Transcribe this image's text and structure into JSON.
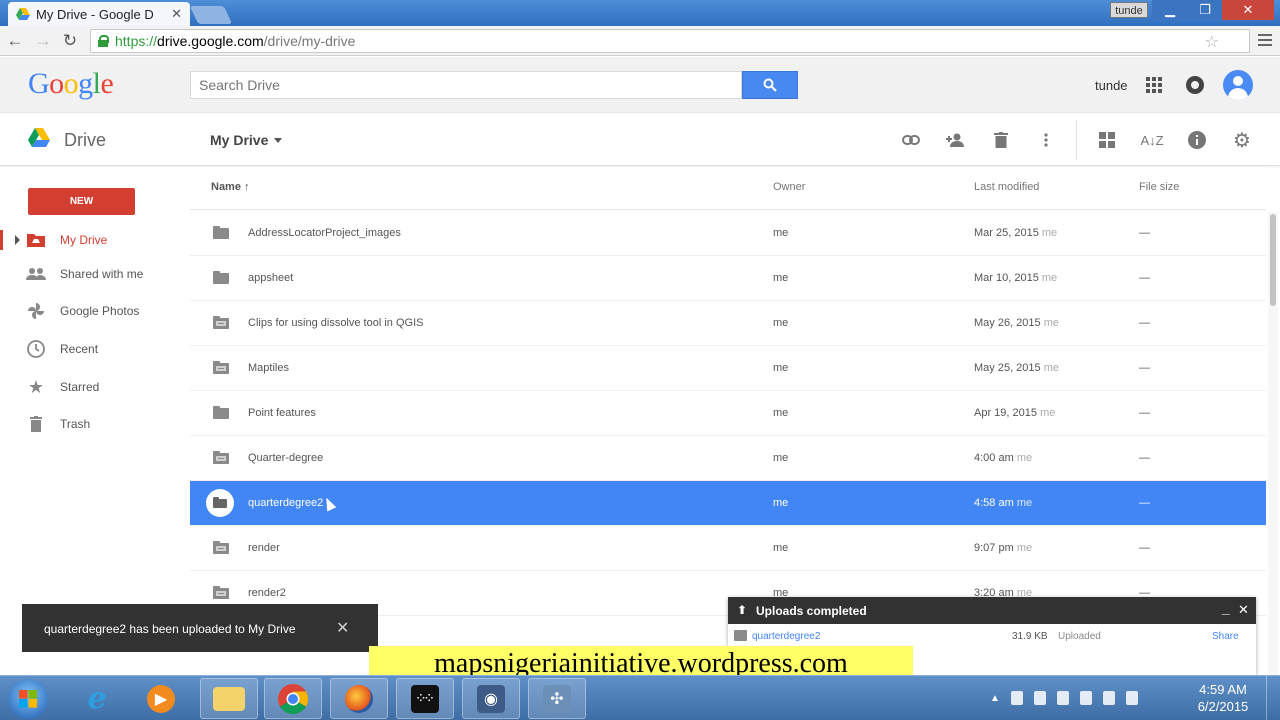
{
  "browser": {
    "tab_title": "My Drive - Google D",
    "tab_close": "✕",
    "profile_user": "tunde",
    "url_scheme": "https://",
    "url_host": "drive.google.com",
    "url_path": "/drive/my-drive"
  },
  "header": {
    "logo_letters": [
      "G",
      "o",
      "o",
      "g",
      "l",
      "e"
    ],
    "logo_colors": [
      "#4285f4",
      "#ea4335",
      "#fbbc05",
      "#4285f4",
      "#34a853",
      "#ea4335"
    ],
    "search_placeholder": "Search Drive",
    "user_name": "tunde"
  },
  "drive_bar": {
    "app_title": "Drive",
    "location": "My Drive"
  },
  "sidebar": {
    "new_label": "NEW",
    "items": [
      {
        "label": "My Drive",
        "icon": "drive-folder-icon",
        "active": true
      },
      {
        "label": "Shared with me",
        "icon": "people-icon",
        "active": false
      },
      {
        "label": "Google Photos",
        "icon": "photos-pinwheel-icon",
        "active": false
      },
      {
        "label": "Recent",
        "icon": "clock-icon",
        "active": false
      },
      {
        "label": "Starred",
        "icon": "star-icon",
        "active": false
      },
      {
        "label": "Trash",
        "icon": "trash-icon",
        "active": false
      }
    ]
  },
  "file_list": {
    "columns": {
      "name": "Name ↑",
      "owner": "Owner",
      "modified": "Last modified",
      "size": "File size"
    },
    "rows": [
      {
        "name": "AddressLocatorProject_images",
        "owner": "me",
        "modified": "Mar 25, 2015",
        "modified_by": "me",
        "size": "—",
        "shared": false,
        "selected": false
      },
      {
        "name": "appsheet",
        "owner": "me",
        "modified": "Mar 10, 2015",
        "modified_by": "me",
        "size": "—",
        "shared": false,
        "selected": false
      },
      {
        "name": "Clips for using dissolve tool in QGIS",
        "owner": "me",
        "modified": "May 26, 2015",
        "modified_by": "me",
        "size": "—",
        "shared": true,
        "selected": false
      },
      {
        "name": "Maptiles",
        "owner": "me",
        "modified": "May 25, 2015",
        "modified_by": "me",
        "size": "—",
        "shared": true,
        "selected": false
      },
      {
        "name": "Point features",
        "owner": "me",
        "modified": "Apr 19, 2015",
        "modified_by": "me",
        "size": "—",
        "shared": false,
        "selected": false
      },
      {
        "name": "Quarter-degree",
        "owner": "me",
        "modified": "4:00 am",
        "modified_by": "me",
        "size": "—",
        "shared": true,
        "selected": false
      },
      {
        "name": "quarterdegree2",
        "owner": "me",
        "modified": "4:58 am",
        "modified_by": "me",
        "size": "—",
        "shared": false,
        "selected": true
      },
      {
        "name": "render",
        "owner": "me",
        "modified": "9:07 pm",
        "modified_by": "me",
        "size": "—",
        "shared": true,
        "selected": false
      },
      {
        "name": "render2",
        "owner": "me",
        "modified": "3:20 am",
        "modified_by": "me",
        "size": "—",
        "shared": true,
        "selected": false
      }
    ]
  },
  "toast": {
    "message": "quarterdegree2 has been uploaded to My Drive",
    "close": "✕"
  },
  "uploads": {
    "title": "Uploads completed",
    "minimize": "_",
    "close": "✕",
    "items": [
      {
        "name": "quarterdegree2",
        "size": "31.9 KB",
        "status": "Uploaded",
        "action": "Share"
      }
    ]
  },
  "watermark": "mapsnigeriainitiative.wordpress.com",
  "taskbar": {
    "time": "4:59 AM",
    "date": "6/2/2015"
  }
}
